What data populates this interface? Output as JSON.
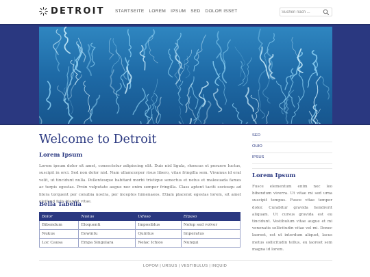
{
  "brand": {
    "name": "DETROIT"
  },
  "nav": {
    "items": [
      "STARTSEITE",
      "LOREM",
      "IPSUM",
      "SED",
      "DOLOR ISSET"
    ]
  },
  "search": {
    "placeholder": "Suchen nach ..."
  },
  "main": {
    "title": "Welcome to Detroit",
    "section1_title": "Lorem Ipsum",
    "section1_text": "Lorem ipsum dolor sit amet, consectetur adipiscing elit. Duis nisl ligula, rhoncus et posuere luctus, suscipit in orci. Sed non dolor nisl. Nam ullamcorper risus libero, vitae fringilla sem. Vivamus id erat velit, ut tincidunt nulla. Pellentesque habitant morbi tristique senectus et netus et malesuada fames ac turpis egestas. Proin vulputate augue nec enim semper fringilla. Class aptent taciti sociosqu ad litora torquent per conubia nostra, per inceptos himenaeos. Etiam placerat egestas lorem, sit amet eleifend felis blandit vitae.",
    "section2_title": "Bella Tabella",
    "table": {
      "headers": [
        "Bolor",
        "Nukus",
        "Udoso",
        "Elpaso"
      ],
      "rows": [
        [
          "Bibendum",
          "Eloquenti",
          "Imposiblus",
          "Nolep sed volver"
        ],
        [
          "Nukus",
          "Eewintu",
          "Quintus",
          "Imperatus"
        ],
        [
          "Loc Causa",
          "Empa Singulara",
          "Nelac Ichios",
          "Nunqui"
        ]
      ]
    }
  },
  "sidebar": {
    "links": [
      "SED",
      "OUIO",
      "IPSUS"
    ],
    "title": "Lorem Ipsum",
    "text": "Fusce elementum enim nec leo bibendum viverra. Ut vitae mi sed urna suscipit tempus. Fusce vitae tempor dolor. Curabitur gravida hendrerit aliquam. Ut cursus gravida est eu tincidunt. Vestibulum vitae augue et mi venenatis sollicitudin vitae vel mi. Donec laoreet, est ut interdum aliquet, lacus metus sollicitudin tellus, eu laoreet sem magna id lorem."
  },
  "footer": {
    "text": "LOPOM | URSUS | VESTIBULUS | INQUID"
  },
  "colors": {
    "accent": "#2a3880",
    "water": "#1f6fa8"
  },
  "icons": {
    "logo": "sun-burst-icon",
    "search": "search-icon"
  }
}
